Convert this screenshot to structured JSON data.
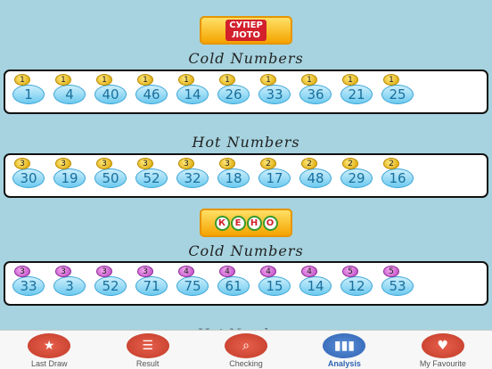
{
  "logos": {
    "super": "СУПЕР\nЛОТО",
    "keno_letters": [
      "К",
      "Е",
      "Н",
      "О"
    ]
  },
  "sections": [
    {
      "heading": "Cold Numbers",
      "balls": [
        {
          "n": "1",
          "c": "1"
        },
        {
          "n": "4",
          "c": "1"
        },
        {
          "n": "40",
          "c": "1"
        },
        {
          "n": "46",
          "c": "1"
        },
        {
          "n": "14",
          "c": "1"
        },
        {
          "n": "26",
          "c": "1"
        },
        {
          "n": "33",
          "c": "1"
        },
        {
          "n": "36",
          "c": "1"
        },
        {
          "n": "21",
          "c": "1"
        },
        {
          "n": "25",
          "c": "1"
        }
      ]
    },
    {
      "heading": "Hot Numbers",
      "balls": [
        {
          "n": "30",
          "c": "3"
        },
        {
          "n": "19",
          "c": "3"
        },
        {
          "n": "50",
          "c": "3"
        },
        {
          "n": "52",
          "c": "3"
        },
        {
          "n": "32",
          "c": "3"
        },
        {
          "n": "18",
          "c": "3"
        },
        {
          "n": "17",
          "c": "2"
        },
        {
          "n": "48",
          "c": "2"
        },
        {
          "n": "29",
          "c": "2"
        },
        {
          "n": "16",
          "c": "2"
        }
      ]
    },
    {
      "heading": "Cold Numbers",
      "balls": [
        {
          "n": "33",
          "c": "3"
        },
        {
          "n": "3",
          "c": "3"
        },
        {
          "n": "52",
          "c": "3"
        },
        {
          "n": "71",
          "c": "3"
        },
        {
          "n": "75",
          "c": "4"
        },
        {
          "n": "61",
          "c": "4"
        },
        {
          "n": "15",
          "c": "4"
        },
        {
          "n": "14",
          "c": "4"
        },
        {
          "n": "12",
          "c": "5"
        },
        {
          "n": "53",
          "c": "5"
        }
      ]
    }
  ],
  "partial_heading": "Hot Numbers",
  "tabs": [
    {
      "label": "Last Draw",
      "icon": "star-icon",
      "active": false
    },
    {
      "label": "Result",
      "icon": "list-icon",
      "active": false
    },
    {
      "label": "Checking",
      "icon": "magnifier-icon",
      "active": false
    },
    {
      "label": "Analysis",
      "icon": "bar-chart-icon",
      "active": true
    },
    {
      "label": "My Favourite",
      "icon": "heart-icon",
      "active": false
    }
  ],
  "colors": {
    "background": "#a6d3df",
    "active_tab": "#2f63b3",
    "tab_icon": "#c23a28"
  }
}
